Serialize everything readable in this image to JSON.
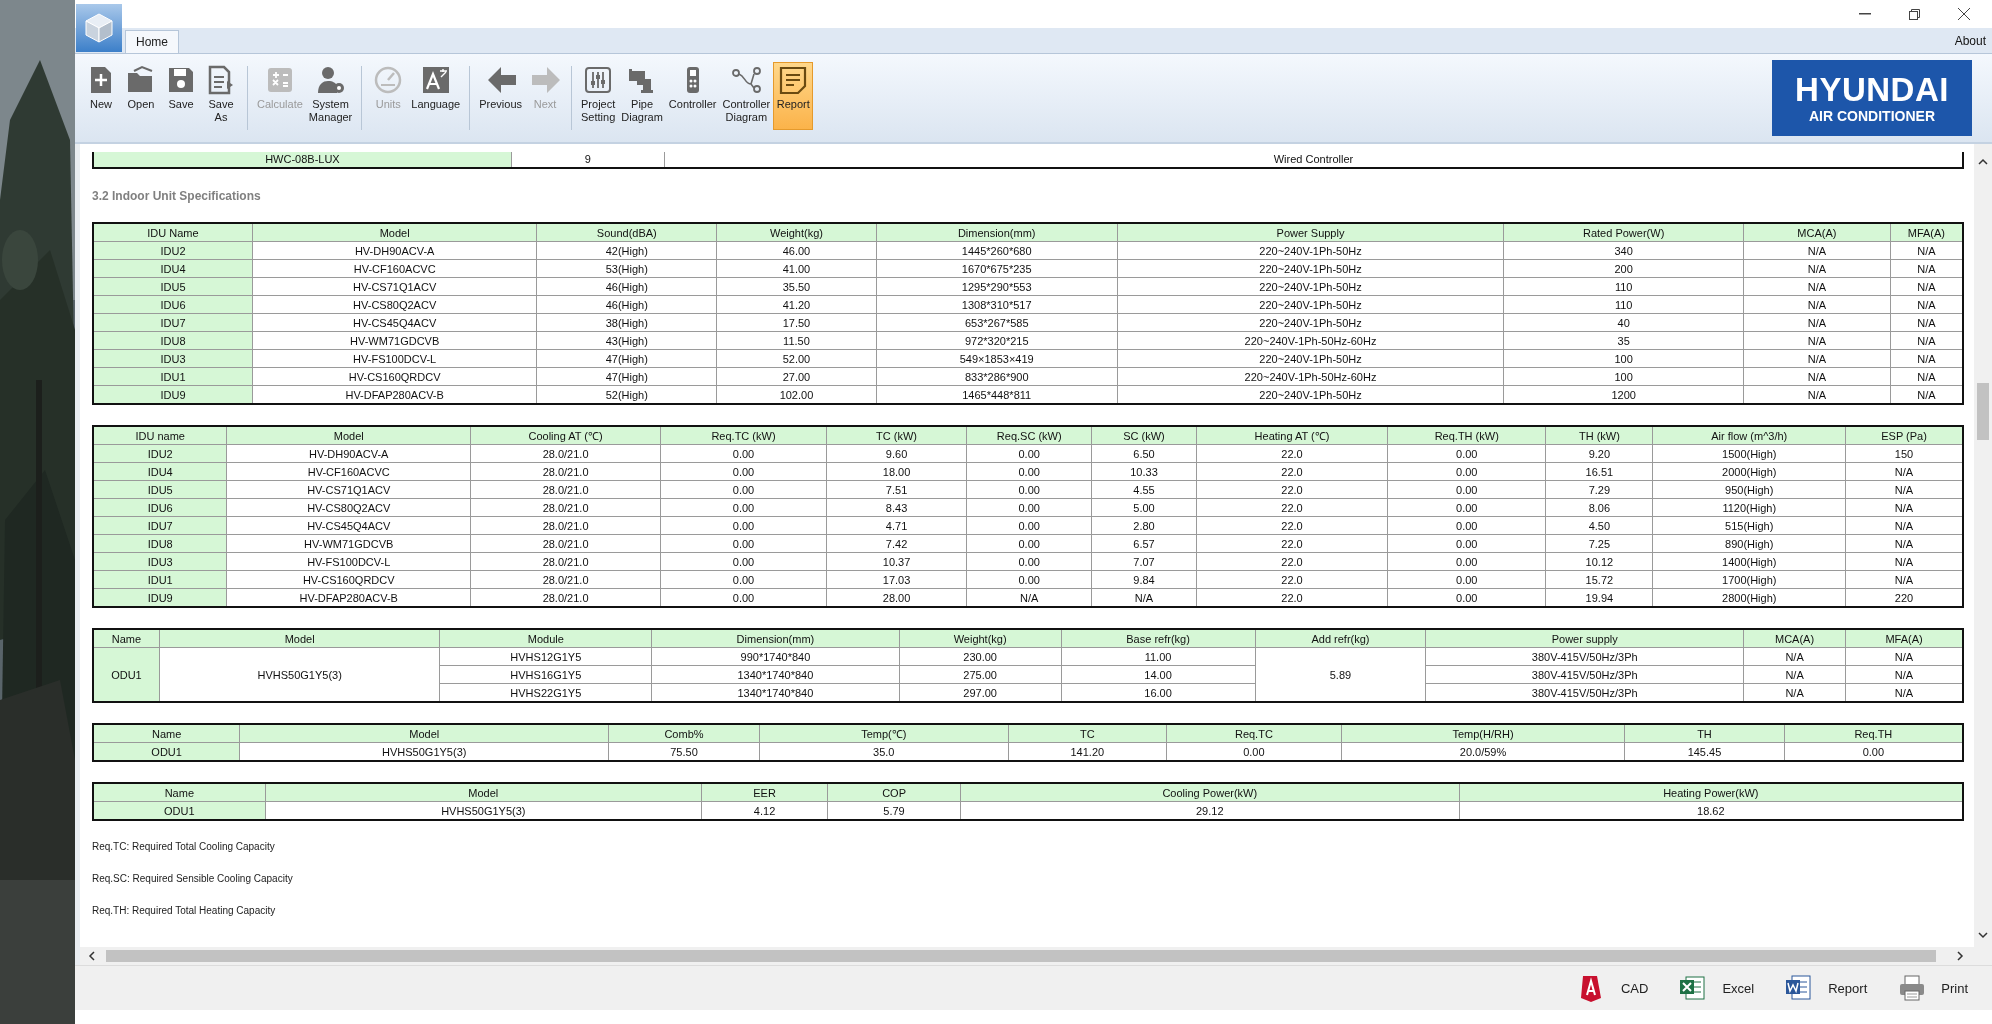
{
  "window": {
    "tabs": [
      {
        "label": "Home",
        "selected": true
      }
    ],
    "about": "About"
  },
  "ribbon": {
    "groups": [
      [
        {
          "label": "New",
          "kind": "new",
          "disabled": false,
          "selected": false
        },
        {
          "label": "Open",
          "kind": "open",
          "disabled": false,
          "selected": false
        },
        {
          "label": "Save",
          "kind": "save",
          "disabled": false,
          "selected": false
        },
        {
          "label": "Save As",
          "kind": "saveas",
          "disabled": false,
          "selected": false
        }
      ],
      [
        {
          "label": "Calculate",
          "kind": "calculate",
          "disabled": true,
          "selected": false
        },
        {
          "label": "System Manager",
          "kind": "manager",
          "disabled": false,
          "selected": false
        }
      ],
      [
        {
          "label": "Units",
          "kind": "units",
          "disabled": true,
          "selected": false
        },
        {
          "label": "Language",
          "kind": "language",
          "disabled": false,
          "selected": false
        }
      ],
      [
        {
          "label": "Previous",
          "kind": "previous",
          "disabled": false,
          "selected": false
        },
        {
          "label": "Next",
          "kind": "next",
          "disabled": true,
          "selected": false
        }
      ],
      [
        {
          "label": "Project Setting",
          "kind": "settings",
          "disabled": false,
          "selected": false
        },
        {
          "label": "Pipe Diagram",
          "kind": "pipe",
          "disabled": false,
          "selected": false
        },
        {
          "label": "Controller",
          "kind": "controller",
          "disabled": false,
          "selected": false
        },
        {
          "label": "Controller Diagram",
          "kind": "diagram",
          "disabled": false,
          "selected": false
        },
        {
          "label": "Report",
          "kind": "report",
          "disabled": false,
          "selected": true
        }
      ]
    ],
    "logo": {
      "brand": "HYUNDAI",
      "subtitle": "AIR CONDITIONER"
    }
  },
  "report": {
    "partial_row": [
      "HWC-08B-LUX",
      "9",
      "Wired Controller"
    ],
    "section_title": "3.2 Indoor Unit Specifications",
    "tables": [
      {
        "kind": "flat",
        "columns": [
          "IDU Name",
          "Model",
          "Sound(dBA)",
          "Weight(kg)",
          "Dimension(mm)",
          "Power Supply",
          "Rated Power(W)",
          "MCA(A)",
          "MFA(A)"
        ],
        "rows": [
          [
            "IDU2",
            "HV-DH90ACV-A",
            "42(High)",
            "46.00",
            "1445*260*680",
            "220~240V-1Ph-50Hz",
            "340",
            "N/A",
            "N/A"
          ],
          [
            "IDU4",
            "HV-CF160ACVC",
            "53(High)",
            "41.00",
            "1670*675*235",
            "220~240V-1Ph-50Hz",
            "200",
            "N/A",
            "N/A"
          ],
          [
            "IDU5",
            "HV-CS71Q1ACV",
            "46(High)",
            "35.50",
            "1295*290*553",
            "220~240V-1Ph-50Hz",
            "110",
            "N/A",
            "N/A"
          ],
          [
            "IDU6",
            "HV-CS80Q2ACV",
            "46(High)",
            "41.20",
            "1308*310*517",
            "220~240V-1Ph-50Hz",
            "110",
            "N/A",
            "N/A"
          ],
          [
            "IDU7",
            "HV-CS45Q4ACV",
            "38(High)",
            "17.50",
            "653*267*585",
            "220~240V-1Ph-50Hz",
            "40",
            "N/A",
            "N/A"
          ],
          [
            "IDU8",
            "HV-WM71GDCVB",
            "43(High)",
            "11.50",
            "972*320*215",
            "220~240V-1Ph-50Hz-60Hz",
            "35",
            "N/A",
            "N/A"
          ],
          [
            "IDU3",
            "HV-FS100DCV-L",
            "47(High)",
            "52.00",
            "549×1853×419",
            "220~240V-1Ph-50Hz",
            "100",
            "N/A",
            "N/A"
          ],
          [
            "IDU1",
            "HV-CS160QRDCV",
            "47(High)",
            "27.00",
            "833*286*900",
            "220~240V-1Ph-50Hz-60Hz",
            "100",
            "N/A",
            "N/A"
          ],
          [
            "IDU9",
            "HV-DFAP280ACV-B",
            "52(High)",
            "102.00",
            "1465*448*811",
            "220~240V-1Ph-50Hz",
            "1200",
            "N/A",
            "N/A"
          ]
        ]
      },
      {
        "kind": "flat",
        "columns": [
          "IDU name",
          "Model",
          "Cooling AT (℃)",
          "Req.TC (kW)",
          "TC (kW)",
          "Req.SC (kW)",
          "SC (kW)",
          "Heating AT (℃)",
          "Req.TH (kW)",
          "TH (kW)",
          "Air flow (m^3/h)",
          "ESP (Pa)"
        ],
        "rows": [
          [
            "IDU2",
            "HV-DH90ACV-A",
            "28.0/21.0",
            "0.00",
            "9.60",
            "0.00",
            "6.50",
            "22.0",
            "0.00",
            "9.20",
            "1500(High)",
            "150"
          ],
          [
            "IDU4",
            "HV-CF160ACVC",
            "28.0/21.0",
            "0.00",
            "18.00",
            "0.00",
            "10.33",
            "22.0",
            "0.00",
            "16.51",
            "2000(High)",
            "N/A"
          ],
          [
            "IDU5",
            "HV-CS71Q1ACV",
            "28.0/21.0",
            "0.00",
            "7.51",
            "0.00",
            "4.55",
            "22.0",
            "0.00",
            "7.29",
            "950(High)",
            "N/A"
          ],
          [
            "IDU6",
            "HV-CS80Q2ACV",
            "28.0/21.0",
            "0.00",
            "8.43",
            "0.00",
            "5.00",
            "22.0",
            "0.00",
            "8.06",
            "1120(High)",
            "N/A"
          ],
          [
            "IDU7",
            "HV-CS45Q4ACV",
            "28.0/21.0",
            "0.00",
            "4.71",
            "0.00",
            "2.80",
            "22.0",
            "0.00",
            "4.50",
            "515(High)",
            "N/A"
          ],
          [
            "IDU8",
            "HV-WM71GDCVB",
            "28.0/21.0",
            "0.00",
            "7.42",
            "0.00",
            "6.57",
            "22.0",
            "0.00",
            "7.25",
            "890(High)",
            "N/A"
          ],
          [
            "IDU3",
            "HV-FS100DCV-L",
            "28.0/21.0",
            "0.00",
            "10.37",
            "0.00",
            "7.07",
            "22.0",
            "0.00",
            "10.12",
            "1400(High)",
            "N/A"
          ],
          [
            "IDU1",
            "HV-CS160QRDCV",
            "28.0/21.0",
            "0.00",
            "17.03",
            "0.00",
            "9.84",
            "22.0",
            "0.00",
            "15.72",
            "1700(High)",
            "N/A"
          ],
          [
            "IDU9",
            "HV-DFAP280ACV-B",
            "28.0/21.0",
            "0.00",
            "28.00",
            "N/A",
            "N/A",
            "22.0",
            "0.00",
            "19.94",
            "2800(High)",
            "220"
          ]
        ]
      },
      {
        "kind": "grouped",
        "columns": [
          "Name",
          "Model",
          "Module",
          "Dimension(mm)",
          "Weight(kg)",
          "Base refr(kg)",
          "Add refr(kg)",
          "Power supply",
          "MCA(A)",
          "MFA(A)"
        ],
        "units": [
          {
            "name": "ODU1",
            "model": "HVHS50G1Y5(3)",
            "add_refr": "5.89",
            "modules": [
              [
                "HVHS12G1Y5",
                "990*1740*840",
                "230.00",
                "11.00",
                "380V-415V/50Hz/3Ph",
                "N/A",
                "N/A"
              ],
              [
                "HVHS16G1Y5",
                "1340*1740*840",
                "275.00",
                "14.00",
                "380V-415V/50Hz/3Ph",
                "N/A",
                "N/A"
              ],
              [
                "HVHS22G1Y5",
                "1340*1740*840",
                "297.00",
                "16.00",
                "380V-415V/50Hz/3Ph",
                "N/A",
                "N/A"
              ]
            ]
          }
        ]
      },
      {
        "kind": "flat",
        "columns": [
          "Name",
          "Model",
          "Comb%",
          "Temp(℃)",
          "TC",
          "Req.TC",
          "Temp(H/RH)",
          "TH",
          "Req.TH"
        ],
        "rows": [
          [
            "ODU1",
            "HVHS50G1Y5(3)",
            "75.50",
            "35.0",
            "141.20",
            "0.00",
            "20.0/59%",
            "145.45",
            "0.00"
          ]
        ]
      },
      {
        "kind": "flat",
        "columns": [
          "Name",
          "Model",
          "EER",
          "COP",
          "Cooling Power(kW)",
          "Heating Power(kW)"
        ],
        "rows": [
          [
            "ODU1",
            "HVHS50G1Y5(3)",
            "4.12",
            "5.79",
            "29.12",
            "18.62"
          ]
        ]
      }
    ],
    "notes": [
      "Req.TC: Required Total Cooling Capacity",
      "Req.SC: Required Sensible Cooling Capacity",
      "Req.TH: Required Total Heating Capacity"
    ]
  },
  "export_buttons": [
    {
      "label": "CAD",
      "kind": "cad"
    },
    {
      "label": "Excel",
      "kind": "excel"
    },
    {
      "label": "Report",
      "kind": "report"
    },
    {
      "label": "Print",
      "kind": "print"
    }
  ]
}
